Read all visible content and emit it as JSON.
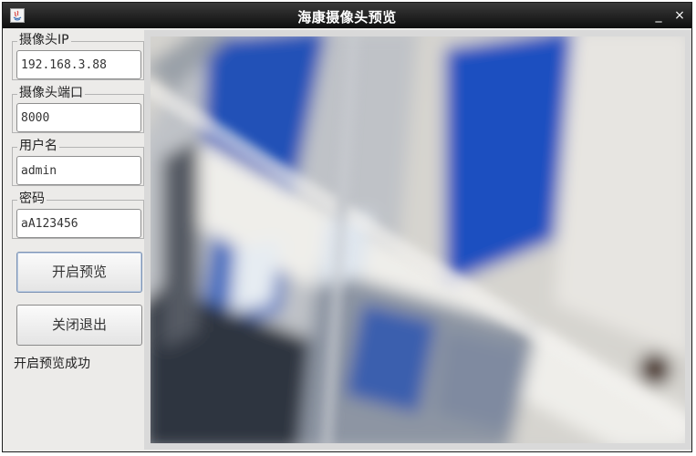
{
  "window": {
    "title": "海康摄像头预览",
    "minimize_glyph": "_",
    "close_glyph": "×",
    "icon": "java-app-icon"
  },
  "form": {
    "ip": {
      "label": "摄像头IP",
      "value": "192.168.3.88"
    },
    "port": {
      "label": "摄像头端口",
      "value": "8000"
    },
    "username": {
      "label": "用户名",
      "value": "admin"
    },
    "password": {
      "label": "密码",
      "value": "aA123456"
    }
  },
  "buttons": {
    "start_preview": "开启预览",
    "close_exit": "关闭退出"
  },
  "status": "开启预览成功",
  "preview": {
    "type": "camera-video-feed",
    "colors": {
      "background": "#cfcfcf",
      "blue": "#2451b7",
      "dark": "#2e3440",
      "light": "#e9e7e2"
    }
  }
}
